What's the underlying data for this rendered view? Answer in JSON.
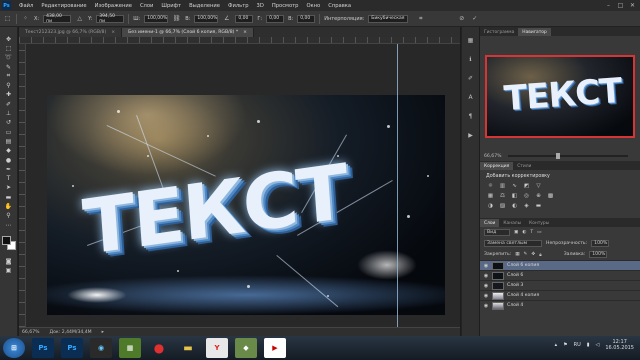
{
  "menubar": {
    "logo": "Ps",
    "items": [
      "Файл",
      "Редактирование",
      "Изображение",
      "Слои",
      "Шрифт",
      "Выделение",
      "Фильтр",
      "3D",
      "Просмотр",
      "Окно",
      "Справка"
    ],
    "minimize": "–",
    "maximize": "□",
    "close": "✕"
  },
  "options": {
    "x_label": "X:",
    "x_value": "438,00 пи",
    "y_label": "Y:",
    "y_value": "394,50 пи",
    "w_label": "Ш:",
    "w_value": "100,00%",
    "h_label": "В:",
    "h_value": "100,00%",
    "angle_value": "0,00",
    "hskew_label": "Г:",
    "hskew_value": "0,00",
    "vskew_label": "В:",
    "vskew_value": "0,00",
    "interp_label": "Интерполяция:",
    "interp_value": "Бикубическая"
  },
  "document": {
    "tabs": [
      {
        "label": "Текст212323.jpg @ 66,7% (RGB/8)",
        "close": "×"
      },
      {
        "label": "Без имени-1 @ 66,7% (Слой 6 копия, RGB/8) *",
        "close": "×"
      }
    ],
    "art_text": "ТЕКСТ",
    "status_zoom": "66,67%",
    "status_doc": "Док: 2,44М/34,4М"
  },
  "panels": {
    "nav_tabs": [
      "Гистограмма",
      "Навигатор"
    ],
    "nav_text": "ТЕКСТ",
    "nav_zoom": "66,67%",
    "adj_tabs": [
      "Коррекция",
      "Стили"
    ],
    "adj_header": "Добавить корректировку",
    "layer_tabs": [
      "Слои",
      "Каналы",
      "Контуры"
    ],
    "kind_label": "Вид",
    "blend_mode": "Замена светлым",
    "opacity_label": "Непрозрачность:",
    "opacity_value": "100%",
    "lock_label": "Закрепить:",
    "fill_label": "Заливка:",
    "fill_value": "100%",
    "layers": [
      {
        "name": "Слой 6 копия",
        "selected": true
      },
      {
        "name": "Слой 6",
        "selected": false
      },
      {
        "name": "Слой 3",
        "selected": false
      },
      {
        "name": "Слой 4 копия",
        "selected": false
      },
      {
        "name": "Слой 4",
        "selected": false
      }
    ]
  },
  "taskbar": {
    "apps": [
      "Ps",
      "Ps"
    ],
    "lang": "RU",
    "time": "12:17",
    "date": "16.05.2015"
  }
}
